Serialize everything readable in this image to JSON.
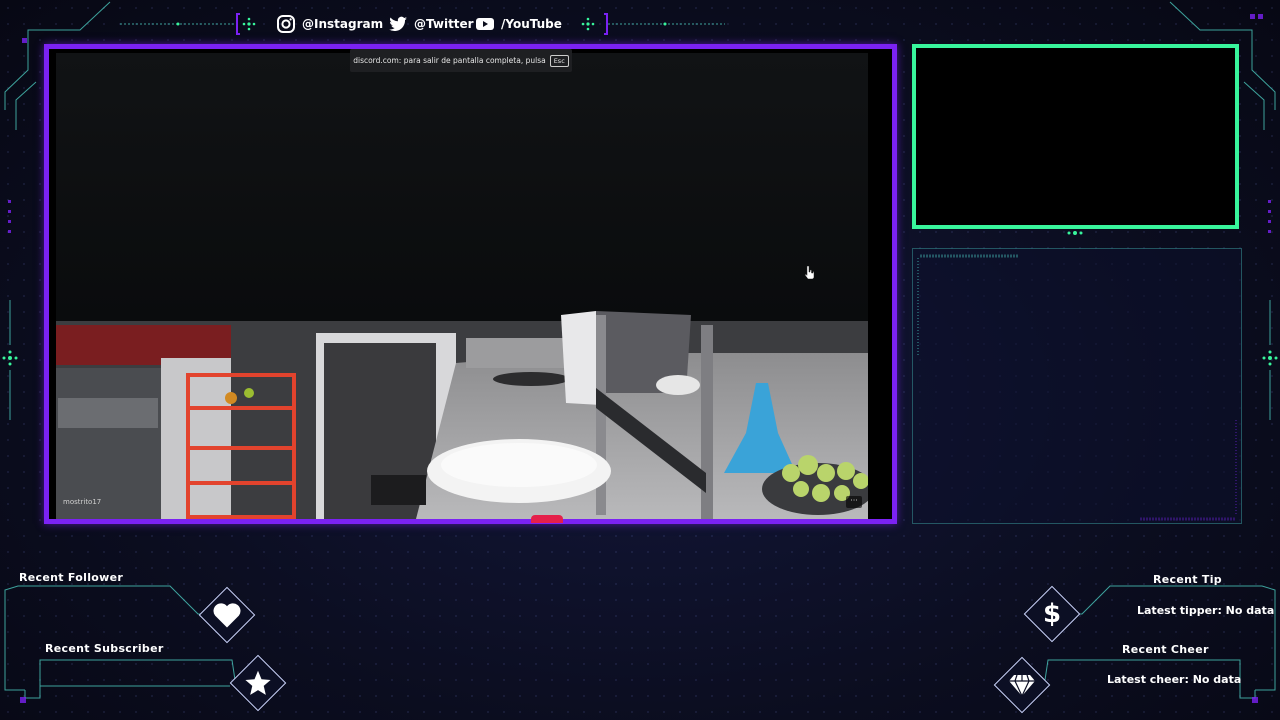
{
  "colors": {
    "accent_purple": "#7b22f3",
    "accent_green": "#38f59c",
    "accent_teal": "#4fd6c8",
    "background": "#0b0d1c"
  },
  "social": [
    {
      "icon": "instagram-icon",
      "label": "@Instagram"
    },
    {
      "icon": "twitter-icon",
      "label": "@Twitter"
    },
    {
      "icon": "youtube-icon",
      "label": "/YouTube"
    }
  ],
  "stream": {
    "discord_notice": "discord.com: para salir de pantalla completa, pulsa",
    "esc_key": "Esc",
    "username": "mostrito17",
    "more_button": "···"
  },
  "alerts": {
    "recent_follower_label": "Recent Follower",
    "recent_subscriber_label": "Recent Subscriber",
    "recent_tip_label": "Recent Tip",
    "latest_tipper": "Latest tipper: No data",
    "recent_cheer_label": "Recent Cheer",
    "latest_cheer": "Latest cheer: No data",
    "follower_icon": "heart-icon",
    "subscriber_icon": "star-icon",
    "tip_icon": "dollar-icon",
    "cheer_icon": "diamond-gem-icon"
  }
}
